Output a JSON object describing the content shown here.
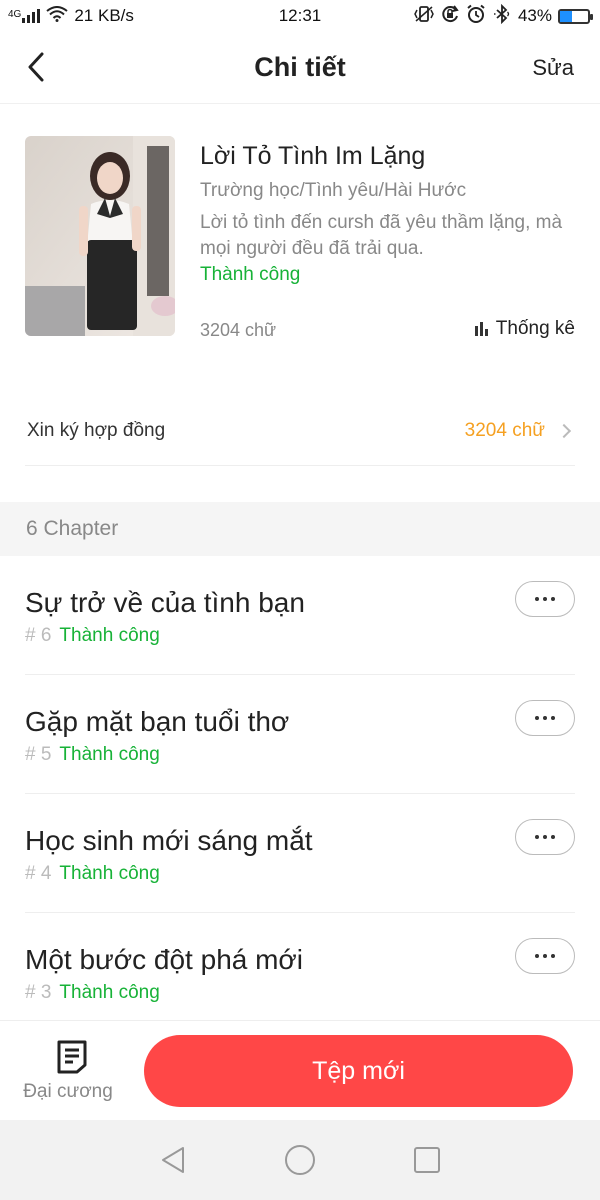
{
  "status_bar": {
    "network": "4G",
    "speed": "21 KB/s",
    "time": "12:31",
    "battery": "43%",
    "battery_level": 0.43,
    "icons": [
      "signal-icon",
      "wifi-icon",
      "vibrate-icon",
      "rotation-lock-icon",
      "alarm-icon",
      "bluetooth-icon",
      "battery-icon"
    ]
  },
  "header": {
    "title": "Chi tiết",
    "edit_label": "Sửa"
  },
  "story": {
    "title": "Lời Tỏ Tình Im Lặng",
    "genre": "Trường học/Tình yêu/Hài Hước",
    "description": "Lời tỏ tình đến cursh đã yêu thầm lặng, mà mọi người đều đã trải qua.",
    "status": "Thành công",
    "word_count": "3204 chữ",
    "stats_label": "Thống kê"
  },
  "contract": {
    "label": "Xin ký hợp đồng",
    "value": "3204 chữ"
  },
  "chapters": {
    "header": "6 Chapter",
    "items": [
      {
        "title": "Sự trở về của tình bạn",
        "number": "# 6",
        "status": "Thành công"
      },
      {
        "title": "Gặp mặt bạn tuổi thơ",
        "number": "# 5",
        "status": "Thành công"
      },
      {
        "title": "Học sinh mới sáng mắt",
        "number": "# 4",
        "status": "Thành công"
      },
      {
        "title": "Một bước đột phá mới",
        "number": "# 3",
        "status": "Thành công"
      }
    ]
  },
  "bottom": {
    "outline_label": "Đại cương",
    "new_file_label": "Tệp mới"
  },
  "colors": {
    "accent_green": "#17b237",
    "accent_orange": "#f5a021",
    "primary_button": "#ff4747"
  }
}
